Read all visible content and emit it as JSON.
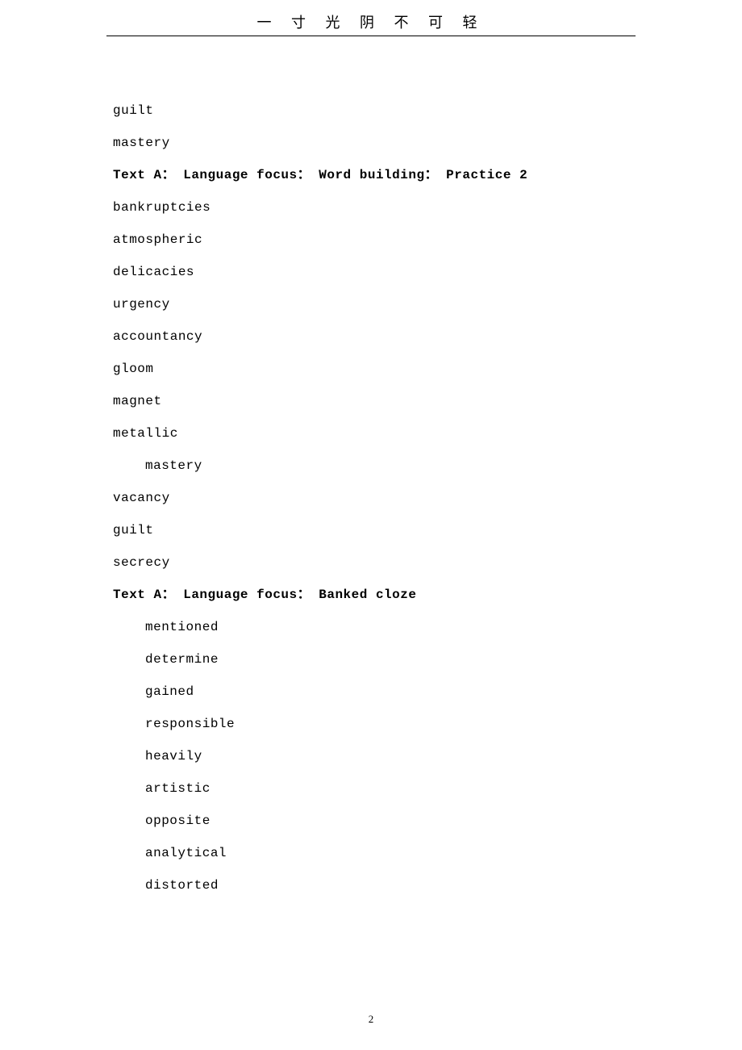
{
  "header": {
    "motto": "一 寸 光 阴 不 可 轻"
  },
  "sections": [
    {
      "pre_items": [
        {
          "text": "guilt",
          "indented": false
        },
        {
          "text": "mastery",
          "indented": false
        }
      ],
      "heading": "Text A： Language focus： Word building： Practice 2",
      "items": [
        {
          "text": "bankruptcies",
          "indented": false
        },
        {
          "text": "atmospheric",
          "indented": false
        },
        {
          "text": "delicacies",
          "indented": false
        },
        {
          "text": "urgency",
          "indented": false
        },
        {
          "text": "accountancy",
          "indented": false
        },
        {
          "text": "gloom",
          "indented": false
        },
        {
          "text": "magnet",
          "indented": false
        },
        {
          "text": "metallic",
          "indented": false
        },
        {
          "text": "mastery",
          "indented": true
        },
        {
          "text": "vacancy",
          "indented": false
        },
        {
          "text": "guilt",
          "indented": false
        },
        {
          "text": "secrecy",
          "indented": false
        }
      ]
    },
    {
      "heading": "Text A： Language focus： Banked cloze",
      "items": [
        {
          "text": "mentioned",
          "indented": true
        },
        {
          "text": "determine",
          "indented": true
        },
        {
          "text": "gained",
          "indented": true
        },
        {
          "text": "responsible",
          "indented": true
        },
        {
          "text": "heavily",
          "indented": true
        },
        {
          "text": "artistic",
          "indented": true
        },
        {
          "text": "opposite",
          "indented": true
        },
        {
          "text": "analytical",
          "indented": true
        },
        {
          "text": "distorted",
          "indented": true
        }
      ]
    }
  ],
  "page_number": "2"
}
